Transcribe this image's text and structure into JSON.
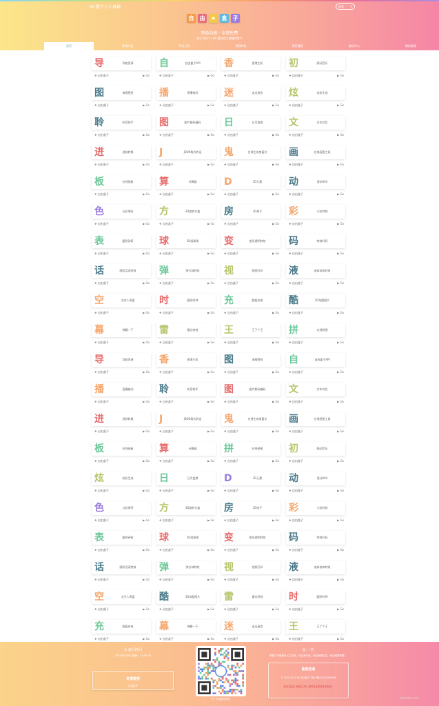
{
  "header": {
    "site_name": "Mr.翟个人工具箱",
    "search_placeholder": "搜索",
    "logo_chars": [
      "自",
      "由",
      "★",
      "盒",
      "子"
    ],
    "logo_colors": [
      "#f59a4a",
      "#e86c7a",
      "#f5c84a",
      "#5cb8e0",
      "#9a7ce0"
    ],
    "slogan": "特色功能 · 全部免费",
    "subslogan": "关于为何个人Mr.翟在线工具箱的简介"
  },
  "nav": [
    "首页",
    "影视传说",
    "开发工具",
    "视频特效",
    "网页漫画",
    "游戏中心",
    "微信助理"
  ],
  "card_meta": "自由盒子",
  "go_label": "Go",
  "tools": [
    {
      "c": "导",
      "t": "导航资源",
      "k": "#e86c6c"
    },
    {
      "c": "自",
      "t": "自由盒子API",
      "k": "#6cc89a"
    },
    {
      "c": "香",
      "t": "香港主机",
      "k": "#f5a66c"
    },
    {
      "c": "初",
      "t": "随动音乐",
      "k": "#b8c46c"
    },
    {
      "c": "图",
      "t": "海报壁纸",
      "k": "#4a7a8a"
    },
    {
      "c": "播",
      "t": "直播夜间",
      "k": "#f5a66c"
    },
    {
      "c": "迷",
      "t": "走出迷宫",
      "k": "#f5a66c"
    },
    {
      "c": "炫",
      "t": "炫彩生成",
      "k": "#b8c46c"
    },
    {
      "c": "聆",
      "t": "听音助手",
      "k": "#4a7a8a"
    },
    {
      "c": "图",
      "t": "图片解码编码",
      "k": "#e86c6c"
    },
    {
      "c": "日",
      "t": "日月变换",
      "k": "#6cc89a"
    },
    {
      "c": "文",
      "t": "文本对比",
      "k": "#b8c46c"
    },
    {
      "c": "进",
      "t": "进制转换",
      "k": "#e86c6c"
    },
    {
      "c": "J",
      "t": "JSON格式转运",
      "k": "#f5a66c"
    },
    {
      "c": "鬼",
      "t": "在线生成鬼畜文",
      "k": "#f5a66c"
    },
    {
      "c": "画",
      "t": "在线画图工具",
      "k": "#4a7a8a"
    },
    {
      "c": "板",
      "t": "在线画板",
      "k": "#6cc89a"
    },
    {
      "c": "算",
      "t": "计算器",
      "k": "#e86c6c"
    },
    {
      "c": "D",
      "t": "3D元素",
      "k": "#f5a66c"
    },
    {
      "c": "动",
      "t": "滚动404",
      "k": "#4a7a8a"
    },
    {
      "c": "色",
      "t": "五彩增亮",
      "k": "#9a7ce0"
    },
    {
      "c": "方",
      "t": "3D旋转方盒",
      "k": "#b8c46c"
    },
    {
      "c": "房",
      "t": "3D房子",
      "k": "#4a7a8a"
    },
    {
      "c": "彩",
      "t": "七彩特效",
      "k": "#f5a66c"
    },
    {
      "c": "表",
      "t": "圆形钟表",
      "k": "#6cc89a"
    },
    {
      "c": "球",
      "t": "3D组球球",
      "k": "#e86c6c"
    },
    {
      "c": "变",
      "t": "变形透明特效",
      "k": "#e86c6c"
    },
    {
      "c": "码",
      "t": "特效代码",
      "k": "#4a7a8a"
    },
    {
      "c": "话",
      "t": "随机话语特效",
      "k": "#4a7a8a"
    },
    {
      "c": "弹",
      "t": "弹力球特效",
      "k": "#6cc89a"
    },
    {
      "c": "视",
      "t": "视频打印",
      "k": "#b8c46c"
    },
    {
      "c": "液",
      "t": "液体流体特效",
      "k": "#4a7a8a"
    },
    {
      "c": "空",
      "t": "太空人表盘",
      "k": "#f5a66c"
    },
    {
      "c": "时",
      "t": "圆形时钟",
      "k": "#e86c6c"
    },
    {
      "c": "充",
      "t": "超级充电",
      "k": "#6cc89a"
    },
    {
      "c": "酷",
      "t": "3D炫酷图片",
      "k": "#4a7a8a"
    },
    {
      "c": "幕",
      "t": "弹幕一下",
      "k": "#f5a66c"
    },
    {
      "c": "雷",
      "t": "雷达特效",
      "k": "#b8c46c"
    },
    {
      "c": "王",
      "t": "王了个王",
      "k": "#b8c46c"
    },
    {
      "c": "拼",
      "t": "在线拼图",
      "k": "#6cc89a"
    },
    {
      "c": "导",
      "t": "导航资源",
      "k": "#e86c6c"
    },
    {
      "c": "香",
      "t": "香港主机",
      "k": "#f5a66c"
    },
    {
      "c": "图",
      "t": "海报壁纸",
      "k": "#4a7a8a"
    },
    {
      "c": "自",
      "t": "自由盒子API",
      "k": "#6cc89a"
    },
    {
      "c": "播",
      "t": "直播夜间",
      "k": "#f5a66c"
    },
    {
      "c": "聆",
      "t": "听音助手",
      "k": "#4a7a8a"
    },
    {
      "c": "图",
      "t": "图片解码编码",
      "k": "#e86c6c"
    },
    {
      "c": "文",
      "t": "文本对比",
      "k": "#b8c46c"
    },
    {
      "c": "进",
      "t": "进制转换",
      "k": "#e86c6c"
    },
    {
      "c": "J",
      "t": "JSON格式转运",
      "k": "#f5a66c"
    },
    {
      "c": "鬼",
      "t": "在线生成鬼畜文",
      "k": "#f5a66c"
    },
    {
      "c": "画",
      "t": "在线画图工具",
      "k": "#4a7a8a"
    },
    {
      "c": "板",
      "t": "在线画板",
      "k": "#6cc89a"
    },
    {
      "c": "算",
      "t": "计算器",
      "k": "#e86c6c"
    },
    {
      "c": "拼",
      "t": "在线拼图",
      "k": "#6cc89a"
    },
    {
      "c": "初",
      "t": "随动音乐",
      "k": "#b8c46c"
    },
    {
      "c": "炫",
      "t": "炫彩生成",
      "k": "#b8c46c"
    },
    {
      "c": "日",
      "t": "日月变换",
      "k": "#6cc89a"
    },
    {
      "c": "D",
      "t": "3D元素",
      "k": "#9a7ce0"
    },
    {
      "c": "动",
      "t": "滚动404",
      "k": "#4a7a8a"
    },
    {
      "c": "色",
      "t": "五彩增亮",
      "k": "#9a7ce0"
    },
    {
      "c": "方",
      "t": "3D旋转方盒",
      "k": "#b8c46c"
    },
    {
      "c": "房",
      "t": "3D房子",
      "k": "#4a7a8a"
    },
    {
      "c": "彩",
      "t": "七彩特效",
      "k": "#f5a66c"
    },
    {
      "c": "表",
      "t": "圆形钟表",
      "k": "#6cc89a"
    },
    {
      "c": "球",
      "t": "3D组球球",
      "k": "#e86c6c"
    },
    {
      "c": "变",
      "t": "变形透明特效",
      "k": "#e86c6c"
    },
    {
      "c": "码",
      "t": "特效代码",
      "k": "#4a7a8a"
    },
    {
      "c": "话",
      "t": "随机话语特效",
      "k": "#4a7a8a"
    },
    {
      "c": "弹",
      "t": "弹力球特效",
      "k": "#6cc89a"
    },
    {
      "c": "视",
      "t": "视频打印",
      "k": "#b8c46c"
    },
    {
      "c": "液",
      "t": "液体流体特效",
      "k": "#4a7a8a"
    },
    {
      "c": "空",
      "t": "太空人表盘",
      "k": "#f5a66c"
    },
    {
      "c": "酷",
      "t": "3D炫酷图片",
      "k": "#4a7a8a"
    },
    {
      "c": "雷",
      "t": "雷达特效",
      "k": "#b8c46c"
    },
    {
      "c": "时",
      "t": "圆形时钟",
      "k": "#e86c6c"
    },
    {
      "c": "充",
      "t": "超级充电",
      "k": "#6cc89a"
    },
    {
      "c": "幕",
      "t": "弹幕一下",
      "k": "#f5a66c"
    },
    {
      "c": "迷",
      "t": "走出迷宫",
      "k": "#f5a66c"
    },
    {
      "c": "王",
      "t": "王了个王",
      "k": "#b8c46c"
    }
  ],
  "footer": {
    "left_title": "⊙ 运行时间",
    "left_time": "2024年4月8日 星期一 21:09:38",
    "left_box_title": "友情链接",
    "left_box_text": "自由盒子",
    "qr_caption": "扫一扫加我为好友",
    "right_title": "☺ 一言",
    "right_quote": "青春几乎就是在人生边缘，也会有失误，但这就是生活，而这就是青春！",
    "right_box_title": "备案信息",
    "right_box_line": "© 2020-2024 By 自由盒子.   冀ICP备2024000000号",
    "right_box_red": "本站主机由【网络之号】提供并且提供技术支持！"
  },
  "watermark": "lab.ihaas.com"
}
